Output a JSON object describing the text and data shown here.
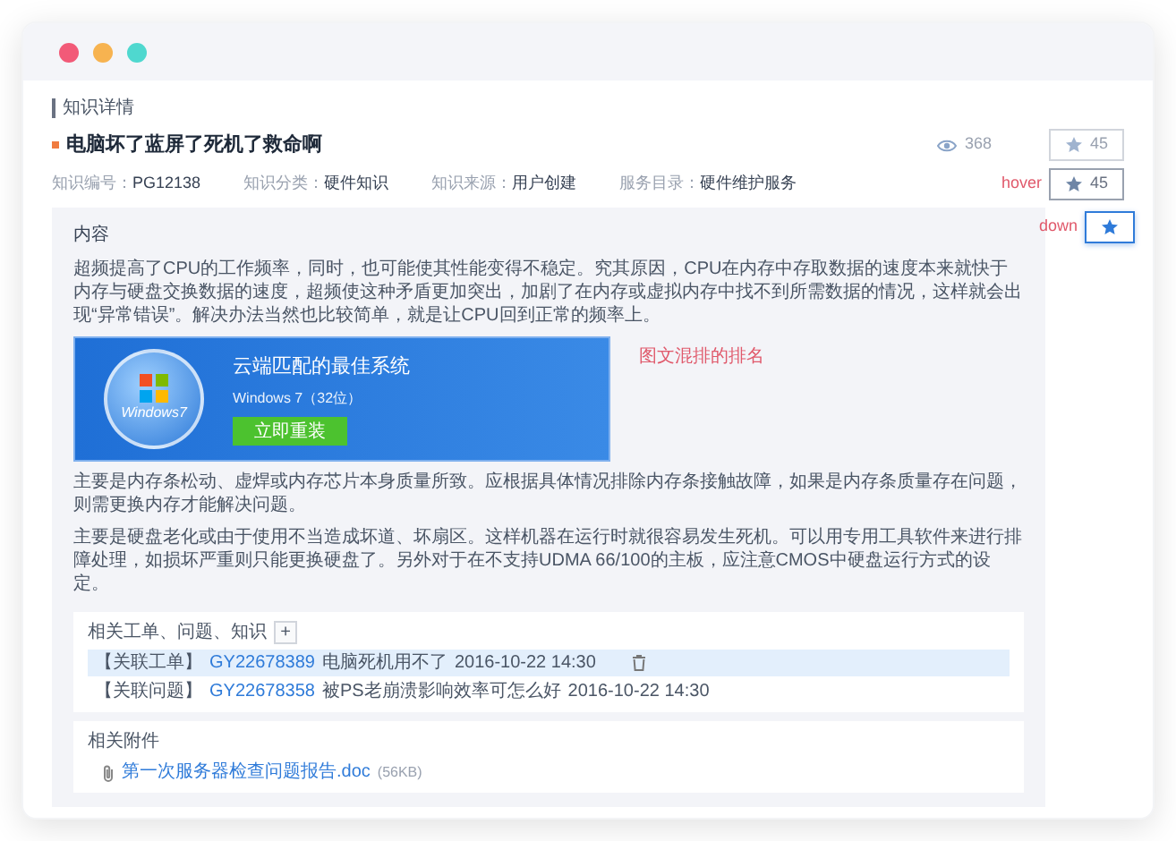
{
  "window": {
    "dots": [
      {
        "color": "#f25a78"
      },
      {
        "color": "#f7b350"
      },
      {
        "color": "#4fd8cf"
      }
    ]
  },
  "section_title": "知识详情",
  "article": {
    "title": "电脑坏了蓝屏了死机了救命啊",
    "views": "368",
    "meta": [
      {
        "label": "知识编号：",
        "value": "PG12138"
      },
      {
        "label": "知识分类：",
        "value": "硬件知识"
      },
      {
        "label": "知识来源：",
        "value": "用户创建"
      },
      {
        "label": "服务目录：",
        "value": "硬件维护服务"
      }
    ]
  },
  "favorite_buttons": [
    {
      "kind": "idle",
      "count": "45"
    },
    {
      "kind": "hovered",
      "label": "hover",
      "count": "45"
    },
    {
      "kind": "pressed",
      "label": "down"
    }
  ],
  "content": {
    "heading": "内容",
    "note": "图文混排的排名",
    "blocks": [
      {
        "kind": "paragraph",
        "text": "超频提高了CPU的工作频率，同时，也可能使其性能变得不稳定。究其原因，CPU在内存中存取数据的速度本来就快于内存与硬盘交换数据的速度，超频使这种矛盾更加突出，加剧了在内存或虚拟内存中找不到所需数据的情况，这样就会出现“异常错误”。解决办法当然也比较简单，就是让CPU回到正常的频率上。"
      },
      {
        "kind": "banner",
        "title": "云端匹配的最佳系统",
        "subtitle": "Windows 7（32位）",
        "logo_text": "Windows7",
        "button": "立即重装"
      },
      {
        "kind": "paragraph",
        "text": "主要是内存条松动、虚焊或内存芯片本身质量所致。应根据具体情况排除内存条接触故障，如果是内存条质量存在问题，则需更换内存才能解决问题。"
      },
      {
        "kind": "paragraph",
        "text": "主要是硬盘老化或由于使用不当造成坏道、坏扇区。这样机器在运行时就很容易发生死机。可以用专用工具软件来进行排障处理，如损坏严重则只能更换硬盘了。另外对于在不支持UDMA 66/100的主板，应注意CMOS中硬盘运行方式的设定。"
      }
    ]
  },
  "related": {
    "title": "相关工单、问题、知识",
    "add_button": "+",
    "items": [
      {
        "type": "【关联工单】",
        "code": "GY22678389",
        "subject": "电脑死机用不了",
        "time": "2016-10-22 14:30",
        "highlighted": true
      },
      {
        "type": "【关联问题】",
        "code": "GY22678358",
        "subject": "被PS老崩溃影响效率可怎么好",
        "time": "2016-10-22 14:30",
        "highlighted": false
      }
    ]
  },
  "attachments": {
    "title": "相关附件",
    "files": [
      {
        "name": "第一次服务器检查问题报告.doc",
        "size": "(56KB)"
      }
    ]
  }
}
